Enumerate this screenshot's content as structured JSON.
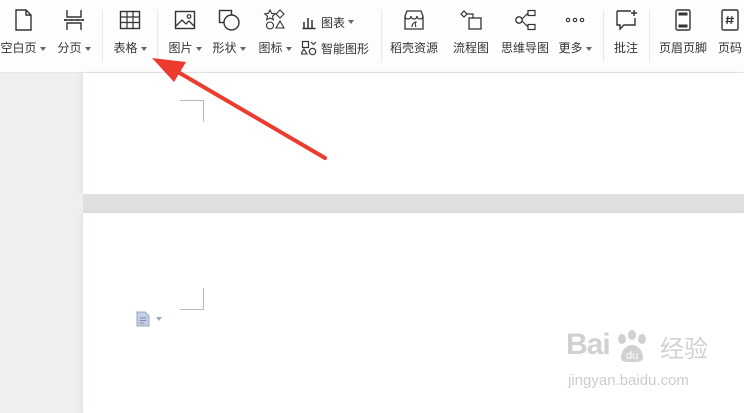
{
  "toolbar": {
    "blank_page": "空白页",
    "page_break": "分页",
    "table": "表格",
    "picture": "图片",
    "shape": "形状",
    "icon": "图标",
    "chart": "图表",
    "smart_art": "智能图形",
    "daoke_resources": "稻壳资源",
    "flowchart": "流程图",
    "mindmap": "思维导图",
    "more": "更多",
    "comment": "批注",
    "header_footer": "页眉页脚",
    "page_number": "页码"
  },
  "watermark": {
    "logo_text": "Bai",
    "logo_text_end": "du",
    "logo_cn": "经验",
    "url": "jingyan.baidu.com"
  },
  "colors": {
    "arrow": "#ee3b2f",
    "paragraph_icon": "#98a7c8"
  }
}
